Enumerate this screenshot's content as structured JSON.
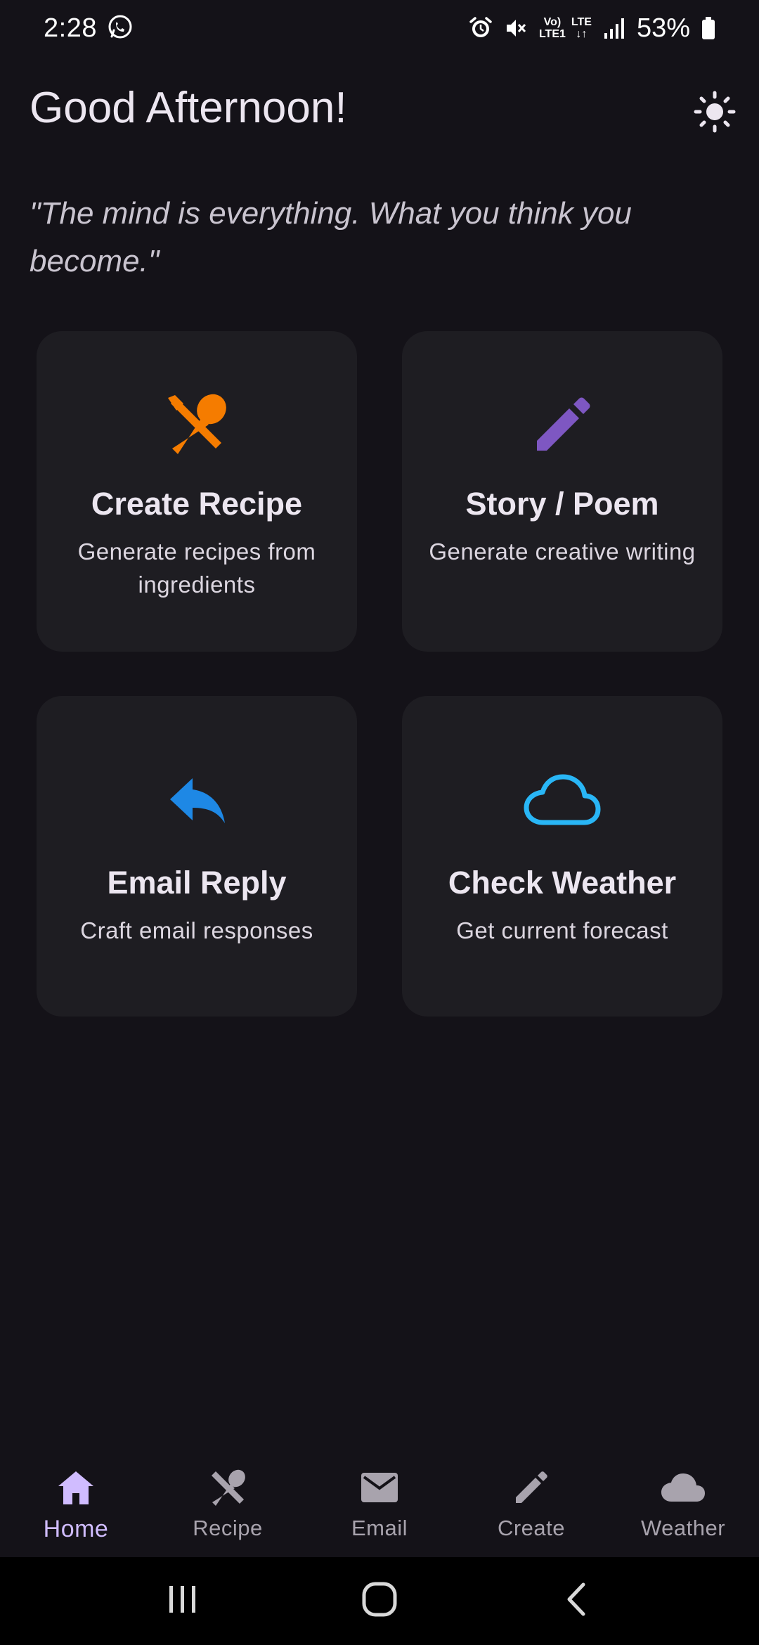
{
  "status_bar": {
    "time": "2:28",
    "network_volte": "Vo)",
    "network_lte1": "LTE1",
    "network_lte": "LTE",
    "battery": "53%",
    "icons": [
      "whatsapp-icon",
      "alarm-icon",
      "mute-icon",
      "signal-icon",
      "battery-icon"
    ]
  },
  "header": {
    "greeting": "Good Afternoon!",
    "theme_icon": "sun-icon"
  },
  "quote": "\"The mind is everything. What you think you become.\"",
  "cards": [
    {
      "title": "Create Recipe",
      "description": "Generate recipes from ingredients",
      "icon": "utensils-icon",
      "color": "#f57c00"
    },
    {
      "title": "Story / Poem",
      "description": "Generate creative writing",
      "icon": "pencil-icon",
      "color": "#7e57c2"
    },
    {
      "title": "Email Reply",
      "description": "Craft email responses",
      "icon": "reply-icon",
      "color": "#1e88e5"
    },
    {
      "title": "Check Weather",
      "description": "Get current forecast",
      "icon": "cloud-icon",
      "color": "#29b6f6"
    }
  ],
  "bottom_nav": {
    "items": [
      {
        "label": "Home",
        "icon": "home-icon",
        "active": true
      },
      {
        "label": "Recipe",
        "icon": "utensils-icon",
        "active": false
      },
      {
        "label": "Email",
        "icon": "mail-icon",
        "active": false
      },
      {
        "label": "Create",
        "icon": "pencil-icon",
        "active": false
      },
      {
        "label": "Weather",
        "icon": "cloud-icon",
        "active": false
      }
    ],
    "active_color": "#d0bcff",
    "inactive_color": "#a8a3ad"
  },
  "system_nav": {
    "icons": [
      "recents-icon",
      "home-button-icon",
      "back-icon"
    ]
  },
  "colors": {
    "background": "#141218",
    "card": "#1e1d22",
    "text": "#ece6f0"
  }
}
